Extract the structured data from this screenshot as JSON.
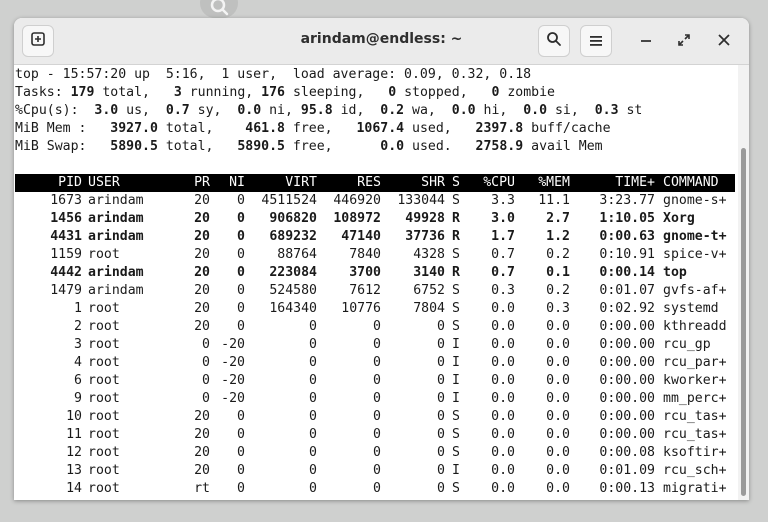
{
  "window": {
    "title": "arindam@endless: ~"
  },
  "summary": [
    [
      {
        "t": "top - 15:57:20 up  5:16,  1 user,  load average: 0.09, 0.32, 0.18"
      }
    ],
    [
      {
        "t": "Tasks: "
      },
      {
        "t": "179",
        "b": true
      },
      {
        "t": " total,   "
      },
      {
        "t": "3",
        "b": true
      },
      {
        "t": " running, "
      },
      {
        "t": "176",
        "b": true
      },
      {
        "t": " sleeping,   "
      },
      {
        "t": "0",
        "b": true
      },
      {
        "t": " stopped,   "
      },
      {
        "t": "0",
        "b": true
      },
      {
        "t": " zombie"
      }
    ],
    [
      {
        "t": "%Cpu(s):  "
      },
      {
        "t": "3.0",
        "b": true
      },
      {
        "t": " us,  "
      },
      {
        "t": "0.7",
        "b": true
      },
      {
        "t": " sy,  "
      },
      {
        "t": "0.0",
        "b": true
      },
      {
        "t": " ni, "
      },
      {
        "t": "95.8",
        "b": true
      },
      {
        "t": " id,  "
      },
      {
        "t": "0.2",
        "b": true
      },
      {
        "t": " wa,  "
      },
      {
        "t": "0.0",
        "b": true
      },
      {
        "t": " hi,  "
      },
      {
        "t": "0.0",
        "b": true
      },
      {
        "t": " si,  "
      },
      {
        "t": "0.3",
        "b": true
      },
      {
        "t": " st"
      }
    ],
    [
      {
        "t": "MiB Mem :   "
      },
      {
        "t": "3927.0",
        "b": true
      },
      {
        "t": " total,    "
      },
      {
        "t": "461.8",
        "b": true
      },
      {
        "t": " free,   "
      },
      {
        "t": "1067.4",
        "b": true
      },
      {
        "t": " used,   "
      },
      {
        "t": "2397.8",
        "b": true
      },
      {
        "t": " buff/cache"
      }
    ],
    [
      {
        "t": "MiB Swap:   "
      },
      {
        "t": "5890.5",
        "b": true
      },
      {
        "t": " total,   "
      },
      {
        "t": "5890.5",
        "b": true
      },
      {
        "t": " free,      "
      },
      {
        "t": "0.0",
        "b": true
      },
      {
        "t": " used.   "
      },
      {
        "t": "2758.9",
        "b": true
      },
      {
        "t": " avail Mem"
      }
    ]
  ],
  "columns": [
    "PID",
    "USER",
    "PR",
    "NI",
    "VIRT",
    "RES",
    "SHR",
    "S",
    "%CPU",
    "%MEM",
    "TIME+",
    "COMMAND"
  ],
  "processes": [
    {
      "pid": "1673",
      "user": "arindam",
      "pr": "20",
      "ni": "0",
      "virt": "4511524",
      "res": "446920",
      "shr": "133044",
      "s": "S",
      "cpu": "3.3",
      "mem": "11.1",
      "time": "3:23.77",
      "cmd": "gnome-s+",
      "bold": false
    },
    {
      "pid": "1456",
      "user": "arindam",
      "pr": "20",
      "ni": "0",
      "virt": "906820",
      "res": "108972",
      "shr": "49928",
      "s": "R",
      "cpu": "3.0",
      "mem": "2.7",
      "time": "1:10.05",
      "cmd": "Xorg",
      "bold": true
    },
    {
      "pid": "4431",
      "user": "arindam",
      "pr": "20",
      "ni": "0",
      "virt": "689232",
      "res": "47140",
      "shr": "37736",
      "s": "R",
      "cpu": "1.7",
      "mem": "1.2",
      "time": "0:00.63",
      "cmd": "gnome-t+",
      "bold": true
    },
    {
      "pid": "1159",
      "user": "root",
      "pr": "20",
      "ni": "0",
      "virt": "88764",
      "res": "7840",
      "shr": "4328",
      "s": "S",
      "cpu": "0.7",
      "mem": "0.2",
      "time": "0:10.91",
      "cmd": "spice-v+",
      "bold": false
    },
    {
      "pid": "4442",
      "user": "arindam",
      "pr": "20",
      "ni": "0",
      "virt": "223084",
      "res": "3700",
      "shr": "3140",
      "s": "R",
      "cpu": "0.7",
      "mem": "0.1",
      "time": "0:00.14",
      "cmd": "top",
      "bold": true
    },
    {
      "pid": "1479",
      "user": "arindam",
      "pr": "20",
      "ni": "0",
      "virt": "524580",
      "res": "7612",
      "shr": "6752",
      "s": "S",
      "cpu": "0.3",
      "mem": "0.2",
      "time": "0:01.07",
      "cmd": "gvfs-af+",
      "bold": false
    },
    {
      "pid": "1",
      "user": "root",
      "pr": "20",
      "ni": "0",
      "virt": "164340",
      "res": "10776",
      "shr": "7804",
      "s": "S",
      "cpu": "0.0",
      "mem": "0.3",
      "time": "0:02.92",
      "cmd": "systemd",
      "bold": false
    },
    {
      "pid": "2",
      "user": "root",
      "pr": "20",
      "ni": "0",
      "virt": "0",
      "res": "0",
      "shr": "0",
      "s": "S",
      "cpu": "0.0",
      "mem": "0.0",
      "time": "0:00.00",
      "cmd": "kthreadd",
      "bold": false
    },
    {
      "pid": "3",
      "user": "root",
      "pr": "0",
      "ni": "-20",
      "virt": "0",
      "res": "0",
      "shr": "0",
      "s": "I",
      "cpu": "0.0",
      "mem": "0.0",
      "time": "0:00.00",
      "cmd": "rcu_gp",
      "bold": false
    },
    {
      "pid": "4",
      "user": "root",
      "pr": "0",
      "ni": "-20",
      "virt": "0",
      "res": "0",
      "shr": "0",
      "s": "I",
      "cpu": "0.0",
      "mem": "0.0",
      "time": "0:00.00",
      "cmd": "rcu_par+",
      "bold": false
    },
    {
      "pid": "6",
      "user": "root",
      "pr": "0",
      "ni": "-20",
      "virt": "0",
      "res": "0",
      "shr": "0",
      "s": "I",
      "cpu": "0.0",
      "mem": "0.0",
      "time": "0:00.00",
      "cmd": "kworker+",
      "bold": false
    },
    {
      "pid": "9",
      "user": "root",
      "pr": "0",
      "ni": "-20",
      "virt": "0",
      "res": "0",
      "shr": "0",
      "s": "I",
      "cpu": "0.0",
      "mem": "0.0",
      "time": "0:00.00",
      "cmd": "mm_perc+",
      "bold": false
    },
    {
      "pid": "10",
      "user": "root",
      "pr": "20",
      "ni": "0",
      "virt": "0",
      "res": "0",
      "shr": "0",
      "s": "S",
      "cpu": "0.0",
      "mem": "0.0",
      "time": "0:00.00",
      "cmd": "rcu_tas+",
      "bold": false
    },
    {
      "pid": "11",
      "user": "root",
      "pr": "20",
      "ni": "0",
      "virt": "0",
      "res": "0",
      "shr": "0",
      "s": "S",
      "cpu": "0.0",
      "mem": "0.0",
      "time": "0:00.00",
      "cmd": "rcu_tas+",
      "bold": false
    },
    {
      "pid": "12",
      "user": "root",
      "pr": "20",
      "ni": "0",
      "virt": "0",
      "res": "0",
      "shr": "0",
      "s": "S",
      "cpu": "0.0",
      "mem": "0.0",
      "time": "0:00.08",
      "cmd": "ksoftir+",
      "bold": false
    },
    {
      "pid": "13",
      "user": "root",
      "pr": "20",
      "ni": "0",
      "virt": "0",
      "res": "0",
      "shr": "0",
      "s": "I",
      "cpu": "0.0",
      "mem": "0.0",
      "time": "0:01.09",
      "cmd": "rcu_sch+",
      "bold": false
    },
    {
      "pid": "14",
      "user": "root",
      "pr": "rt",
      "ni": "0",
      "virt": "0",
      "res": "0",
      "shr": "0",
      "s": "S",
      "cpu": "0.0",
      "mem": "0.0",
      "time": "0:00.13",
      "cmd": "migrati+",
      "bold": false
    }
  ],
  "icons": {
    "background": "search-icon",
    "new_tab": "new-tab-icon",
    "search": "search-icon",
    "menu": "hamburger-menu-icon",
    "minimize": "minimize-icon",
    "maximize": "maximize-icon",
    "close": "close-icon"
  },
  "colors": {
    "header_bg": "#000000",
    "header_fg": "#ffffff",
    "terminal_bg": "#ffffff",
    "text": "#1a1a1a",
    "titlebar_bg": "#ebebeb"
  }
}
